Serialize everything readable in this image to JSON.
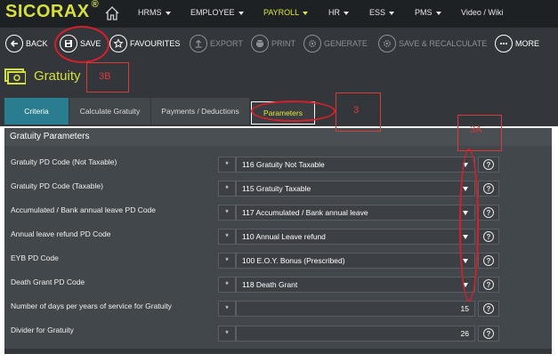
{
  "app": {
    "logo": "SICORAX",
    "logo_mark": "®"
  },
  "nav": {
    "items": [
      {
        "label": "HRMS",
        "caret": true
      },
      {
        "label": "EMPLOYEE",
        "caret": true
      },
      {
        "label": "PAYROLL",
        "caret": true,
        "active": true
      },
      {
        "label": "HR",
        "caret": true
      },
      {
        "label": "ESS",
        "caret": true
      },
      {
        "label": "PMS",
        "caret": true
      },
      {
        "label": "Video / Wiki",
        "caret": false
      }
    ]
  },
  "toolbar": {
    "back": "BACK",
    "save": "SAVE",
    "favourites": "FAVOURITES",
    "export": "EXPORT",
    "print": "PRINT",
    "generate": "GENERATE",
    "save_recalculate": "SAVE & RECALCULATE",
    "more": "MORE"
  },
  "page": {
    "title": "Gratuity"
  },
  "tabs": [
    {
      "label": "Criteria"
    },
    {
      "label": "Calculate Gratuity"
    },
    {
      "label": "Payments / Deductions"
    },
    {
      "label": "Parameters",
      "active": true
    }
  ],
  "section": {
    "title": "Gratuity Parameters"
  },
  "form": {
    "required_mark": "*",
    "help_glyph": "?",
    "rows": [
      {
        "label": "Gratuity PD Code (Not Taxable)",
        "value": "116 Gratuity Not Taxable",
        "type": "dropdown"
      },
      {
        "label": "Gratuity PD Code (Taxable)",
        "value": "115 Gratuity Taxable",
        "type": "dropdown"
      },
      {
        "label": "Accumulated / Bank annual leave PD Code",
        "value": "117 Accumulated / Bank annual leave",
        "type": "dropdown"
      },
      {
        "label": "Annual leave refund PD Code",
        "value": "110 Annual Leave refund",
        "type": "dropdown"
      },
      {
        "label": "EYB PD Code",
        "value": "100 E.O.Y. Bonus (Prescribed)",
        "type": "dropdown"
      },
      {
        "label": "Death Grant PD Code",
        "value": "118 Death Grant",
        "type": "dropdown"
      },
      {
        "label": "Number of days per years of service for Gratuity",
        "value": "15",
        "type": "number"
      },
      {
        "label": "Divider for Gratuity",
        "value": "26",
        "type": "number"
      }
    ]
  },
  "annotations": {
    "save_marker": "3B",
    "tab_marker": "3",
    "column_marker": "3A"
  },
  "colors": {
    "accent": "#d6e03a",
    "annotation": "#d61f2a",
    "tab_first": "#2a7d8e"
  }
}
